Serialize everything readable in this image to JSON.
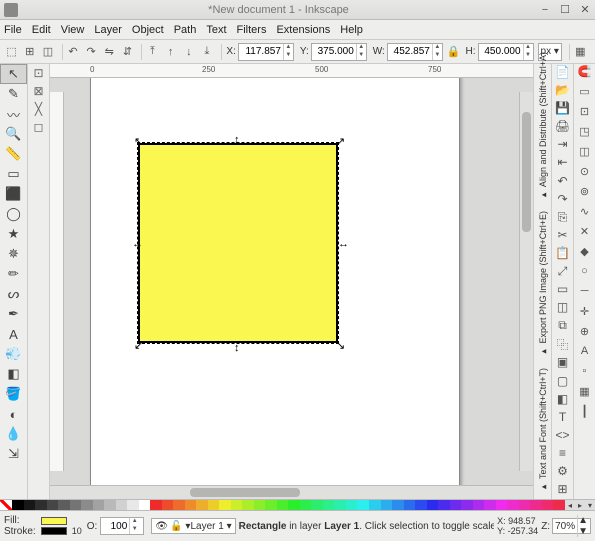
{
  "titlebar": {
    "title": "*New document 1 - Inkscape"
  },
  "menus": [
    "File",
    "Edit",
    "View",
    "Layer",
    "Object",
    "Path",
    "Text",
    "Filters",
    "Extensions",
    "Help"
  ],
  "coords": {
    "x_label": "X:",
    "x": "117.857",
    "y_label": "Y:",
    "y": "375.000",
    "w_label": "W:",
    "w": "452.857",
    "h_label": "H:",
    "h": "450.000",
    "unit": "px"
  },
  "ruler": {
    "m0": "0",
    "m250": "250",
    "m500": "500",
    "m750": "750"
  },
  "canvas": {
    "rect_fill": "#faf850"
  },
  "dock_tabs": [
    "Align and Distribute (Shift+Ctrl+A)",
    "Export PNG Image (Shift+Ctrl+E)",
    "Text and Font (Shift+Ctrl+T)"
  ],
  "status": {
    "fill_label": "Fill:",
    "stroke_label": "Stroke:",
    "fill_color": "#faf850",
    "stroke_color": "#000000",
    "stroke_width": "10",
    "opacity_label": "O:",
    "opacity": "100",
    "layer_name": "Layer 1",
    "msg_pre": "Rectangle",
    "msg_mid": " in layer ",
    "msg_layer": "Layer 1",
    "msg_rest": ". Click selection to toggle scale/rotation handles",
    "x_label": "X:",
    "x": "948.57",
    "y_label": "Y:",
    "y": "-257.34",
    "zoom_label": "Z:",
    "zoom": "70%"
  }
}
